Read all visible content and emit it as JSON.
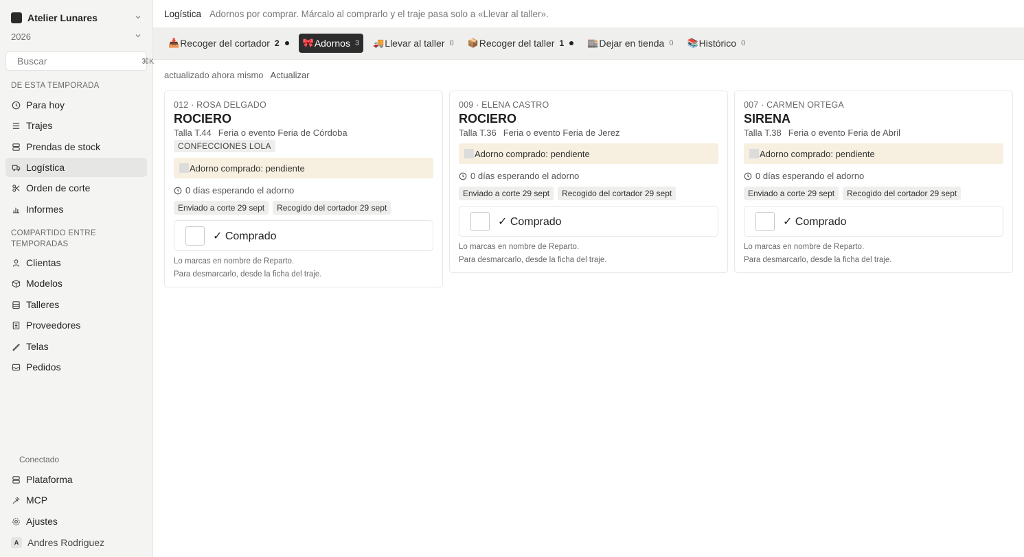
{
  "sidebar": {
    "workspace": "Atelier Lunares",
    "year": "2026",
    "search_placeholder": "Buscar",
    "search_kbd": "⌘K",
    "section1": "DE ESTA TEMPORADA",
    "items1": [
      {
        "label": "Para hoy",
        "icon": "clock-icon"
      },
      {
        "label": "Trajes",
        "icon": "layers-icon"
      },
      {
        "label": "Prendas de stock",
        "icon": "stack-icon"
      },
      {
        "label": "Logística",
        "icon": "truck-icon"
      },
      {
        "label": "Orden de corte",
        "icon": "scissors-icon"
      },
      {
        "label": "Informes",
        "icon": "chart-icon"
      }
    ],
    "section2_line1": "COMPARTIDO ENTRE",
    "section2_line2": "TEMPORADAS",
    "items2": [
      {
        "label": "Clientas",
        "icon": "user-icon"
      },
      {
        "label": "Modelos",
        "icon": "box-icon"
      },
      {
        "label": "Talleres",
        "icon": "building-icon"
      },
      {
        "label": "Proveedores",
        "icon": "store-icon"
      },
      {
        "label": "Telas",
        "icon": "needle-icon"
      },
      {
        "label": "Pedidos",
        "icon": "inbox-icon"
      }
    ],
    "connected": "Conectado",
    "items3": [
      {
        "label": "Plataforma",
        "icon": "server-icon"
      },
      {
        "label": "MCP",
        "icon": "plug-icon"
      },
      {
        "label": "Ajustes",
        "icon": "gear-icon"
      }
    ],
    "user_initial": "A",
    "user_name": "Andres Rodriguez"
  },
  "header": {
    "title": "Logística",
    "subtitle": "Adornos por comprar. Márcalo al comprarlo y el traje pasa solo a «Llevar al taller»."
  },
  "tabs": [
    {
      "emoji": "📥",
      "label": "Recoger del cortador",
      "count": "2",
      "dot": true
    },
    {
      "emoji": "🎀",
      "label": "Adornos",
      "count": "3",
      "dot": false
    },
    {
      "emoji": "🚚",
      "label": "Llevar al taller",
      "count": "0",
      "dot": false
    },
    {
      "emoji": "📦",
      "label": "Recoger del taller",
      "count": "1",
      "dot": true
    },
    {
      "emoji": "🏬",
      "label": "Dejar en tienda",
      "count": "0",
      "dot": false
    },
    {
      "emoji": "📚",
      "label": "Histórico",
      "count": "0",
      "dot": false
    }
  ],
  "update": {
    "status": "actualizado ahora mismo",
    "action": "Actualizar"
  },
  "cards": [
    {
      "code": "012 · ROSA DELGADO",
      "model": "ROCIERO",
      "size": "Talla T.44",
      "event": "Feria o evento Feria de Córdoba",
      "tag": "CONFECCIONES LOLA",
      "warning": "Adorno comprado: pendiente",
      "wait": "0 días esperando el adorno",
      "chip1": "Enviado a corte 29 sept",
      "chip2": "Recogido del cortador 29 sept",
      "button": "✓ Comprado",
      "note1": "Lo marcas en nombre de Reparto.",
      "note2": "Para desmarcarlo, desde la ficha del traje."
    },
    {
      "code": "009 · ELENA CASTRO",
      "model": "ROCIERO",
      "size": "Talla T.36",
      "event": "Feria o evento Feria de Jerez",
      "warning": "Adorno comprado: pendiente",
      "wait": "0 días esperando el adorno",
      "chip1": "Enviado a corte 29 sept",
      "chip2": "Recogido del cortador 29 sept",
      "button": "✓ Comprado",
      "note1": "Lo marcas en nombre de Reparto.",
      "note2": "Para desmarcarlo, desde la ficha del traje."
    },
    {
      "code": "007 · CARMEN ORTEGA",
      "model": "SIRENA",
      "size": "Talla T.38",
      "event": "Feria o evento Feria de Abril",
      "warning": "Adorno comprado: pendiente",
      "wait": "0 días esperando el adorno",
      "chip1": "Enviado a corte 29 sept",
      "chip2": "Recogido del cortador 29 sept",
      "button": "✓ Comprado",
      "note1": "Lo marcas en nombre de Reparto.",
      "note2": "Para desmarcarlo, desde la ficha del traje."
    }
  ],
  "colors": {
    "active_tab": "#2d2d2d",
    "warning_bg": "#f7efdf",
    "sidebar_bg": "#f4f4f3"
  }
}
